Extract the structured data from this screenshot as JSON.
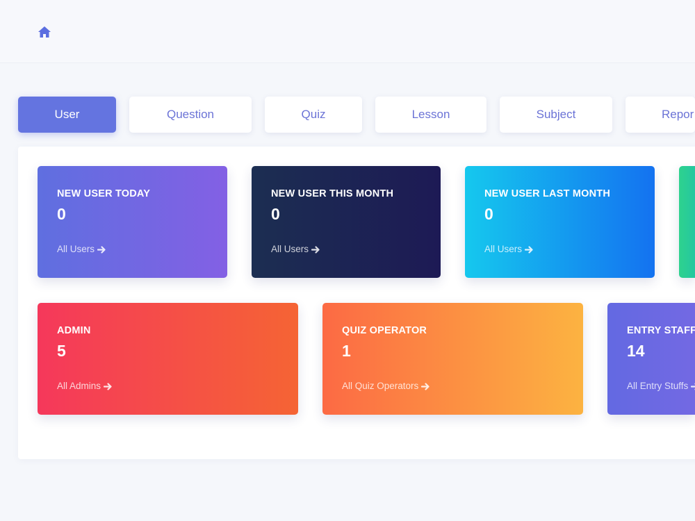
{
  "header": {
    "home_icon": "home-icon"
  },
  "tabs": [
    {
      "label": "User",
      "active": true
    },
    {
      "label": "Question",
      "active": false
    },
    {
      "label": "Quiz",
      "active": false
    },
    {
      "label": "Lesson",
      "active": false
    },
    {
      "label": "Subject",
      "active": false
    },
    {
      "label": "Repor",
      "active": false
    }
  ],
  "cards_row1": [
    {
      "title": "NEW USER TODAY",
      "value": "0",
      "link": "All Users",
      "gradient": [
        "#5f6fe0",
        "#8360e4"
      ]
    },
    {
      "title": "NEW USER THIS MONTH",
      "value": "0",
      "link": "All Users",
      "gradient": [
        "#1c2e52",
        "#1d1a55"
      ]
    },
    {
      "title": "NEW USER LAST MONTH",
      "value": "0",
      "link": "All Users",
      "gradient": [
        "#15c8ee",
        "#1472f0"
      ]
    },
    {
      "gradient": [
        "#2ed28e",
        "#25c7a0"
      ]
    }
  ],
  "cards_row2": [
    {
      "title": "ADMIN",
      "value": "5",
      "link": "All Admins",
      "gradient": [
        "#f5385b",
        "#f56434"
      ]
    },
    {
      "title": "QUIZ OPERATOR",
      "value": "1",
      "link": "All Quiz Operators",
      "gradient": [
        "#fc6a44",
        "#fcb341"
      ]
    },
    {
      "title": "ENTRY STAFF",
      "value": "14",
      "link": "All Entry Stuffs",
      "gradient": [
        "#6369e2",
        "#7369e3"
      ]
    }
  ],
  "colors": {
    "accent": "#6474e0",
    "tab_text": "#6b73d6",
    "background": "#f5f7fb"
  }
}
